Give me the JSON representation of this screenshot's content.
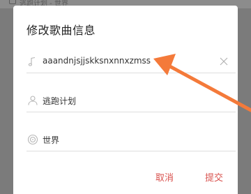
{
  "background": {
    "header_text": "逃跑计划 - 世界"
  },
  "dialog": {
    "title": "修改歌曲信息",
    "fields": {
      "song_title": {
        "value": "aaandnjsjjskksnxnnxzmss",
        "icon": "music-note-icon"
      },
      "artist": {
        "value": "逃跑计划",
        "icon": "person-icon"
      },
      "album": {
        "value": "世界",
        "icon": "disc-icon"
      }
    },
    "buttons": {
      "cancel": "取消",
      "submit": "提交"
    }
  },
  "colors": {
    "accent": "#d9534f",
    "arrow": "#f47a3a",
    "overlay": "#7b7b7b"
  }
}
